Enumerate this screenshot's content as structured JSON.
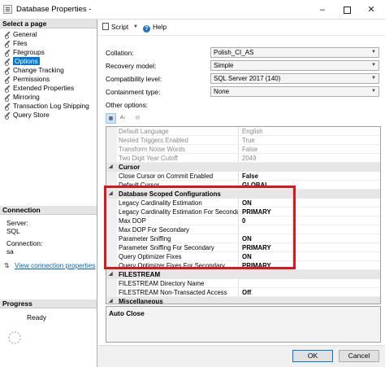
{
  "window": {
    "title": "Database Properties -"
  },
  "left": {
    "select_page_header": "Select a page",
    "pages": [
      {
        "label": "General"
      },
      {
        "label": "Files"
      },
      {
        "label": "Filegroups"
      },
      {
        "label": "Options",
        "selected": true
      },
      {
        "label": "Change Tracking"
      },
      {
        "label": "Permissions"
      },
      {
        "label": "Extended Properties"
      },
      {
        "label": "Mirroring"
      },
      {
        "label": "Transaction Log Shipping"
      },
      {
        "label": "Query Store"
      }
    ],
    "connection_header": "Connection",
    "server_label": "Server:",
    "server_value": "SQL",
    "connection_label": "Connection:",
    "connection_value": "sa",
    "view_connection_link": "View connection properties",
    "progress_header": "Progress",
    "progress_status": "Ready"
  },
  "toolbar": {
    "script_label": "Script",
    "help_label": "Help"
  },
  "fields": {
    "collation": {
      "label": "Collation:",
      "value": "Polish_CI_AS"
    },
    "recovery_model": {
      "label": "Recovery model:",
      "value": "Simple"
    },
    "compatibility_level": {
      "label": "Compatibility level:",
      "value": "SQL Server 2017 (140)"
    },
    "containment_type": {
      "label": "Containment type:",
      "value": "None"
    }
  },
  "other_options_label": "Other options:",
  "grid": {
    "rows": [
      {
        "kind": "prop",
        "name": "Default Language",
        "value": "English",
        "style": "gray"
      },
      {
        "kind": "prop",
        "name": "Nested Triggers Enabled",
        "value": "True",
        "style": "gray"
      },
      {
        "kind": "prop",
        "name": "Transform Noise Words",
        "value": "False",
        "style": "gray"
      },
      {
        "kind": "prop",
        "name": "Two Digit Year Cutoff",
        "value": "2049",
        "style": "gray"
      },
      {
        "kind": "category",
        "name": "Cursor"
      },
      {
        "kind": "prop",
        "name": "Close Cursor on Commit Enabled",
        "value": "False",
        "style": "bold"
      },
      {
        "kind": "prop",
        "name": "Default Cursor",
        "value": "GLOBAL",
        "style": "bold"
      },
      {
        "kind": "category",
        "name": "Database Scoped Configurations"
      },
      {
        "kind": "prop",
        "name": "Legacy Cardinality Estimation",
        "value": "ON",
        "style": "bold"
      },
      {
        "kind": "prop",
        "name": "Legacy Cardinality Estimation For Secondary",
        "value": "PRIMARY",
        "style": "bold"
      },
      {
        "kind": "prop",
        "name": "Max DOP",
        "value": "0",
        "style": "bold"
      },
      {
        "kind": "prop",
        "name": "Max DOP For Secondary",
        "value": "",
        "style": "bold"
      },
      {
        "kind": "prop",
        "name": "Parameter Sniffing",
        "value": "ON",
        "style": "bold"
      },
      {
        "kind": "prop",
        "name": "Parameter Sniffing For Secondary",
        "value": "PRIMARY",
        "style": "bold"
      },
      {
        "kind": "prop",
        "name": "Query Optimizer Fixes",
        "value": "ON",
        "style": "bold"
      },
      {
        "kind": "prop",
        "name": "Query Optimizer Fixes For Secondary",
        "value": "PRIMARY",
        "style": "bold"
      },
      {
        "kind": "category",
        "name": "FILESTREAM"
      },
      {
        "kind": "prop",
        "name": "FILESTREAM Directory Name",
        "value": "",
        "style": "normal"
      },
      {
        "kind": "prop",
        "name": "FILESTREAM Non-Transacted Access",
        "value": "Off",
        "style": "bold"
      },
      {
        "kind": "category",
        "name": "Miscellaneous"
      }
    ]
  },
  "description": {
    "title": "Auto Close"
  },
  "buttons": {
    "ok": "OK",
    "cancel": "Cancel"
  },
  "colors": {
    "highlight_border": "#e0141c",
    "selection": "#0078d7",
    "link": "#0066cc"
  },
  "icons": [
    "database-properties-icon",
    "wrench-icon",
    "script-icon",
    "help-icon",
    "connection-icon",
    "progress-spinner-icon",
    "categorized-icon",
    "alphabetical-icon",
    "property-pages-icon"
  ]
}
